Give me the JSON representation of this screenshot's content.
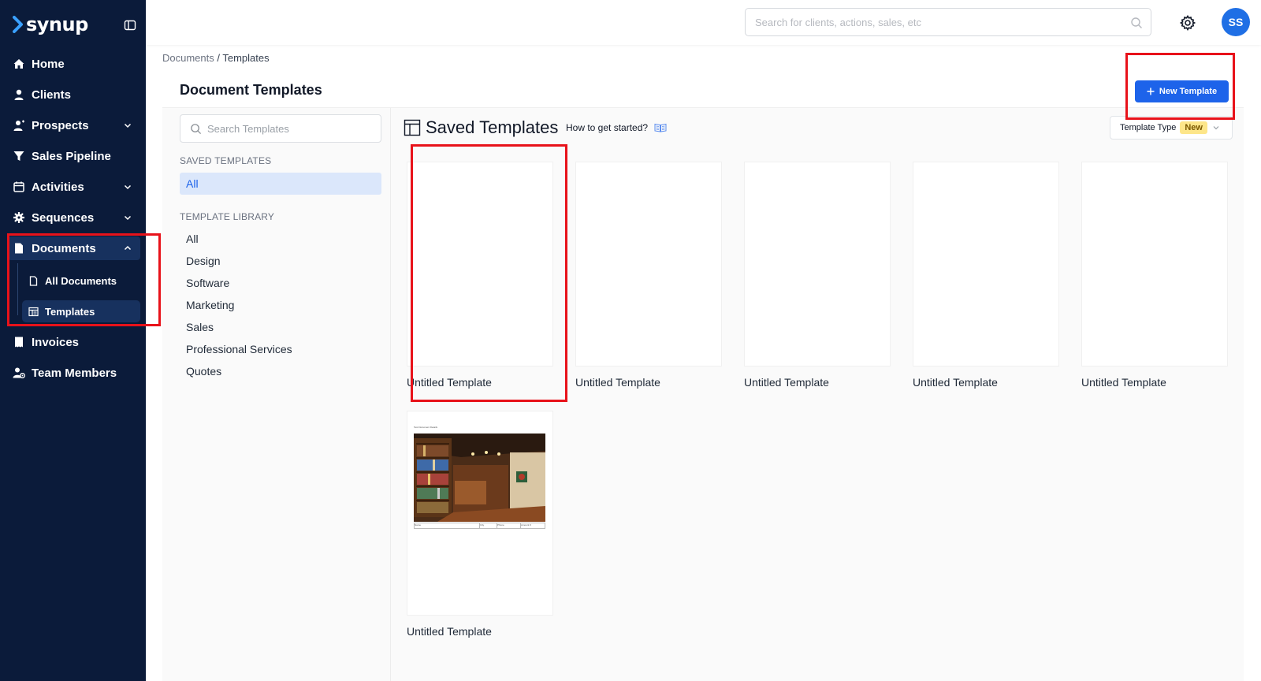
{
  "brand": {
    "name": "synup"
  },
  "sidebar": {
    "items": [
      {
        "label": "Home",
        "icon": "home-icon"
      },
      {
        "label": "Clients",
        "icon": "user-icon"
      },
      {
        "label": "Prospects",
        "icon": "user-plus-icon"
      },
      {
        "label": "Sales Pipeline",
        "icon": "funnel-icon"
      },
      {
        "label": "Activities",
        "icon": "calendar-icon"
      },
      {
        "label": "Sequences",
        "icon": "cog-icon"
      },
      {
        "label": "Documents",
        "icon": "document-icon"
      },
      {
        "label": "Invoices",
        "icon": "receipt-icon"
      },
      {
        "label": "Team Members",
        "icon": "team-icon"
      }
    ],
    "documents_sub": [
      {
        "label": "All Documents",
        "icon": "file-icon"
      },
      {
        "label": "Templates",
        "icon": "template-icon"
      }
    ]
  },
  "header": {
    "search_placeholder": "Search for clients, actions, sales, etc",
    "avatar_initials": "SS"
  },
  "breadcrumb": {
    "parent": "Documents",
    "separator": " / ",
    "current": "Templates"
  },
  "page": {
    "title": "Document Templates",
    "new_button": "New Template"
  },
  "filters": {
    "search_placeholder": "Search Templates",
    "saved_label": "SAVED TEMPLATES",
    "saved_items": [
      "All"
    ],
    "library_label": "TEMPLATE LIBRARY",
    "library_items": [
      "All",
      "Design",
      "Software",
      "Marketing",
      "Sales",
      "Professional Services",
      "Quotes"
    ]
  },
  "content": {
    "title": "Saved Templates",
    "howto": "How to get started?",
    "type_filter_label": "Template Type",
    "type_filter_badge": "New",
    "preview_heading": "Test Document Details",
    "preview_table_headers": [
      "Name",
      "City",
      "Phone",
      "Amount #"
    ]
  },
  "templates": [
    {
      "name": "Untitled Template"
    },
    {
      "name": "Untitled Template"
    },
    {
      "name": "Untitled Template"
    },
    {
      "name": "Untitled Template"
    },
    {
      "name": "Untitled Template"
    },
    {
      "name": "Untitled Template"
    }
  ],
  "colors": {
    "sidebar_bg": "#0b1b3a",
    "accent": "#1d63ea",
    "highlight": "#e8121a",
    "badge": "#fde68a"
  }
}
